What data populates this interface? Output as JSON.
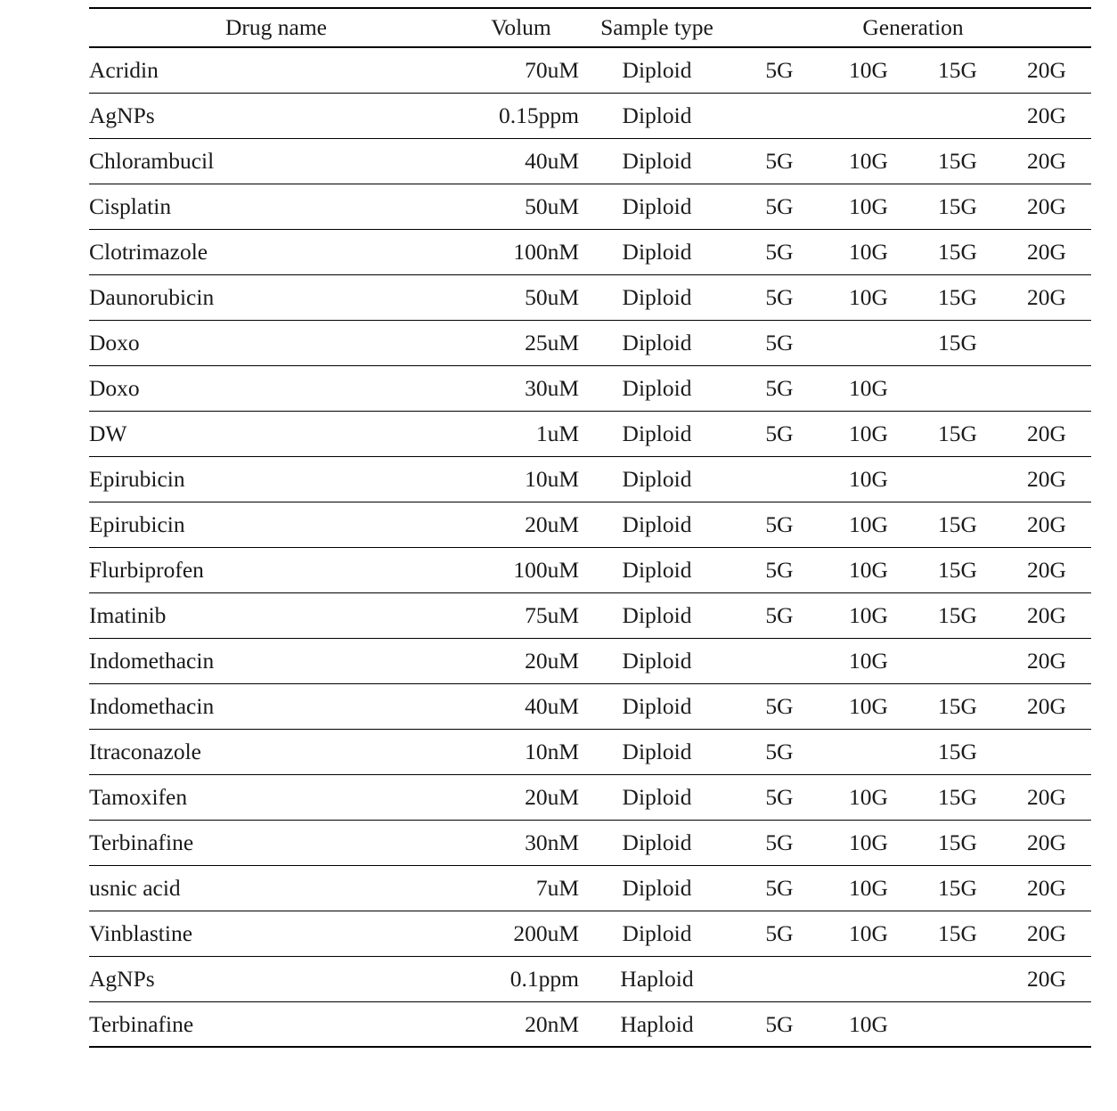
{
  "table": {
    "columns": {
      "drug_name": "Drug  name",
      "volum": "Volum",
      "sample_type": "Sample  type",
      "generation": "Generation"
    },
    "generation_keys": [
      "5G",
      "10G",
      "15G",
      "20G"
    ],
    "rows": [
      {
        "drug": "Acridin",
        "volum": "70uM",
        "type": "Diploid",
        "g5": "5G",
        "g10": "10G",
        "g15": "15G",
        "g20": "20G"
      },
      {
        "drug": "AgNPs",
        "volum": "0.15ppm",
        "type": "Diploid",
        "g5": "",
        "g10": "",
        "g15": "",
        "g20": "20G"
      },
      {
        "drug": "Chlorambucil",
        "volum": "40uM",
        "type": "Diploid",
        "g5": "5G",
        "g10": "10G",
        "g15": "15G",
        "g20": "20G"
      },
      {
        "drug": "Cisplatin",
        "volum": "50uM",
        "type": "Diploid",
        "g5": "5G",
        "g10": "10G",
        "g15": "15G",
        "g20": "20G"
      },
      {
        "drug": "Clotrimazole",
        "volum": "100nM",
        "type": "Diploid",
        "g5": "5G",
        "g10": "10G",
        "g15": "15G",
        "g20": "20G"
      },
      {
        "drug": "Daunorubicin",
        "volum": "50uM",
        "type": "Diploid",
        "g5": "5G",
        "g10": "10G",
        "g15": "15G",
        "g20": "20G"
      },
      {
        "drug": "Doxo",
        "volum": "25uM",
        "type": "Diploid",
        "g5": "5G",
        "g10": "",
        "g15": "15G",
        "g20": ""
      },
      {
        "drug": "Doxo",
        "volum": "30uM",
        "type": "Diploid",
        "g5": "5G",
        "g10": "10G",
        "g15": "",
        "g20": ""
      },
      {
        "drug": "DW",
        "volum": "1uM",
        "type": "Diploid",
        "g5": "5G",
        "g10": "10G",
        "g15": "15G",
        "g20": "20G"
      },
      {
        "drug": "Epirubicin",
        "volum": "10uM",
        "type": "Diploid",
        "g5": "",
        "g10": "10G",
        "g15": "",
        "g20": "20G"
      },
      {
        "drug": "Epirubicin",
        "volum": "20uM",
        "type": "Diploid",
        "g5": "5G",
        "g10": "10G",
        "g15": "15G",
        "g20": "20G"
      },
      {
        "drug": "Flurbiprofen",
        "volum": "100uM",
        "type": "Diploid",
        "g5": "5G",
        "g10": "10G",
        "g15": "15G",
        "g20": "20G"
      },
      {
        "drug": "Imatinib",
        "volum": "75uM",
        "type": "Diploid",
        "g5": "5G",
        "g10": "10G",
        "g15": "15G",
        "g20": "20G"
      },
      {
        "drug": "Indomethacin",
        "volum": "20uM",
        "type": "Diploid",
        "g5": "",
        "g10": "10G",
        "g15": "",
        "g20": "20G"
      },
      {
        "drug": "Indomethacin",
        "volum": "40uM",
        "type": "Diploid",
        "g5": "5G",
        "g10": "10G",
        "g15": "15G",
        "g20": "20G"
      },
      {
        "drug": "Itraconazole",
        "volum": "10nM",
        "type": "Diploid",
        "g5": "5G",
        "g10": "",
        "g15": "15G",
        "g20": ""
      },
      {
        "drug": "Tamoxifen",
        "volum": "20uM",
        "type": "Diploid",
        "g5": "5G",
        "g10": "10G",
        "g15": "15G",
        "g20": "20G"
      },
      {
        "drug": "Terbinafine",
        "volum": "30nM",
        "type": "Diploid",
        "g5": "5G",
        "g10": "10G",
        "g15": "15G",
        "g20": "20G"
      },
      {
        "drug": "usnic  acid",
        "volum": "7uM",
        "type": "Diploid",
        "g5": "5G",
        "g10": "10G",
        "g15": "15G",
        "g20": "20G"
      },
      {
        "drug": "Vinblastine",
        "volum": "200uM",
        "type": "Diploid",
        "g5": "5G",
        "g10": "10G",
        "g15": "15G",
        "g20": "20G"
      },
      {
        "drug": "AgNPs",
        "volum": "0.1ppm",
        "type": "Haploid",
        "g5": "",
        "g10": "",
        "g15": "",
        "g20": "20G"
      },
      {
        "drug": "Terbinafine",
        "volum": "20nM",
        "type": "Haploid",
        "g5": "5G",
        "g10": "10G",
        "g15": "",
        "g20": ""
      }
    ]
  }
}
